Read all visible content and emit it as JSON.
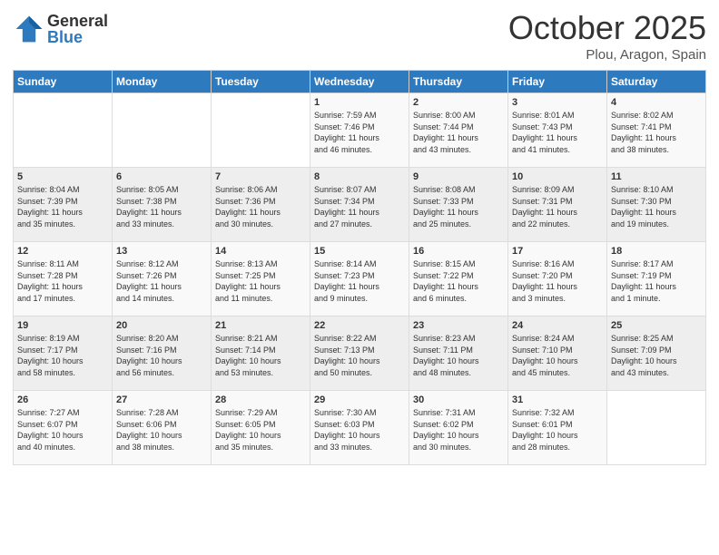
{
  "header": {
    "logo_general": "General",
    "logo_blue": "Blue",
    "title": "October 2025",
    "location": "Plou, Aragon, Spain"
  },
  "days_of_week": [
    "Sunday",
    "Monday",
    "Tuesday",
    "Wednesday",
    "Thursday",
    "Friday",
    "Saturday"
  ],
  "weeks": [
    [
      {
        "day": "",
        "content": ""
      },
      {
        "day": "",
        "content": ""
      },
      {
        "day": "",
        "content": ""
      },
      {
        "day": "1",
        "content": "Sunrise: 7:59 AM\nSunset: 7:46 PM\nDaylight: 11 hours\nand 46 minutes."
      },
      {
        "day": "2",
        "content": "Sunrise: 8:00 AM\nSunset: 7:44 PM\nDaylight: 11 hours\nand 43 minutes."
      },
      {
        "day": "3",
        "content": "Sunrise: 8:01 AM\nSunset: 7:43 PM\nDaylight: 11 hours\nand 41 minutes."
      },
      {
        "day": "4",
        "content": "Sunrise: 8:02 AM\nSunset: 7:41 PM\nDaylight: 11 hours\nand 38 minutes."
      }
    ],
    [
      {
        "day": "5",
        "content": "Sunrise: 8:04 AM\nSunset: 7:39 PM\nDaylight: 11 hours\nand 35 minutes."
      },
      {
        "day": "6",
        "content": "Sunrise: 8:05 AM\nSunset: 7:38 PM\nDaylight: 11 hours\nand 33 minutes."
      },
      {
        "day": "7",
        "content": "Sunrise: 8:06 AM\nSunset: 7:36 PM\nDaylight: 11 hours\nand 30 minutes."
      },
      {
        "day": "8",
        "content": "Sunrise: 8:07 AM\nSunset: 7:34 PM\nDaylight: 11 hours\nand 27 minutes."
      },
      {
        "day": "9",
        "content": "Sunrise: 8:08 AM\nSunset: 7:33 PM\nDaylight: 11 hours\nand 25 minutes."
      },
      {
        "day": "10",
        "content": "Sunrise: 8:09 AM\nSunset: 7:31 PM\nDaylight: 11 hours\nand 22 minutes."
      },
      {
        "day": "11",
        "content": "Sunrise: 8:10 AM\nSunset: 7:30 PM\nDaylight: 11 hours\nand 19 minutes."
      }
    ],
    [
      {
        "day": "12",
        "content": "Sunrise: 8:11 AM\nSunset: 7:28 PM\nDaylight: 11 hours\nand 17 minutes."
      },
      {
        "day": "13",
        "content": "Sunrise: 8:12 AM\nSunset: 7:26 PM\nDaylight: 11 hours\nand 14 minutes."
      },
      {
        "day": "14",
        "content": "Sunrise: 8:13 AM\nSunset: 7:25 PM\nDaylight: 11 hours\nand 11 minutes."
      },
      {
        "day": "15",
        "content": "Sunrise: 8:14 AM\nSunset: 7:23 PM\nDaylight: 11 hours\nand 9 minutes."
      },
      {
        "day": "16",
        "content": "Sunrise: 8:15 AM\nSunset: 7:22 PM\nDaylight: 11 hours\nand 6 minutes."
      },
      {
        "day": "17",
        "content": "Sunrise: 8:16 AM\nSunset: 7:20 PM\nDaylight: 11 hours\nand 3 minutes."
      },
      {
        "day": "18",
        "content": "Sunrise: 8:17 AM\nSunset: 7:19 PM\nDaylight: 11 hours\nand 1 minute."
      }
    ],
    [
      {
        "day": "19",
        "content": "Sunrise: 8:19 AM\nSunset: 7:17 PM\nDaylight: 10 hours\nand 58 minutes."
      },
      {
        "day": "20",
        "content": "Sunrise: 8:20 AM\nSunset: 7:16 PM\nDaylight: 10 hours\nand 56 minutes."
      },
      {
        "day": "21",
        "content": "Sunrise: 8:21 AM\nSunset: 7:14 PM\nDaylight: 10 hours\nand 53 minutes."
      },
      {
        "day": "22",
        "content": "Sunrise: 8:22 AM\nSunset: 7:13 PM\nDaylight: 10 hours\nand 50 minutes."
      },
      {
        "day": "23",
        "content": "Sunrise: 8:23 AM\nSunset: 7:11 PM\nDaylight: 10 hours\nand 48 minutes."
      },
      {
        "day": "24",
        "content": "Sunrise: 8:24 AM\nSunset: 7:10 PM\nDaylight: 10 hours\nand 45 minutes."
      },
      {
        "day": "25",
        "content": "Sunrise: 8:25 AM\nSunset: 7:09 PM\nDaylight: 10 hours\nand 43 minutes."
      }
    ],
    [
      {
        "day": "26",
        "content": "Sunrise: 7:27 AM\nSunset: 6:07 PM\nDaylight: 10 hours\nand 40 minutes."
      },
      {
        "day": "27",
        "content": "Sunrise: 7:28 AM\nSunset: 6:06 PM\nDaylight: 10 hours\nand 38 minutes."
      },
      {
        "day": "28",
        "content": "Sunrise: 7:29 AM\nSunset: 6:05 PM\nDaylight: 10 hours\nand 35 minutes."
      },
      {
        "day": "29",
        "content": "Sunrise: 7:30 AM\nSunset: 6:03 PM\nDaylight: 10 hours\nand 33 minutes."
      },
      {
        "day": "30",
        "content": "Sunrise: 7:31 AM\nSunset: 6:02 PM\nDaylight: 10 hours\nand 30 minutes."
      },
      {
        "day": "31",
        "content": "Sunrise: 7:32 AM\nSunset: 6:01 PM\nDaylight: 10 hours\nand 28 minutes."
      },
      {
        "day": "",
        "content": ""
      }
    ]
  ]
}
